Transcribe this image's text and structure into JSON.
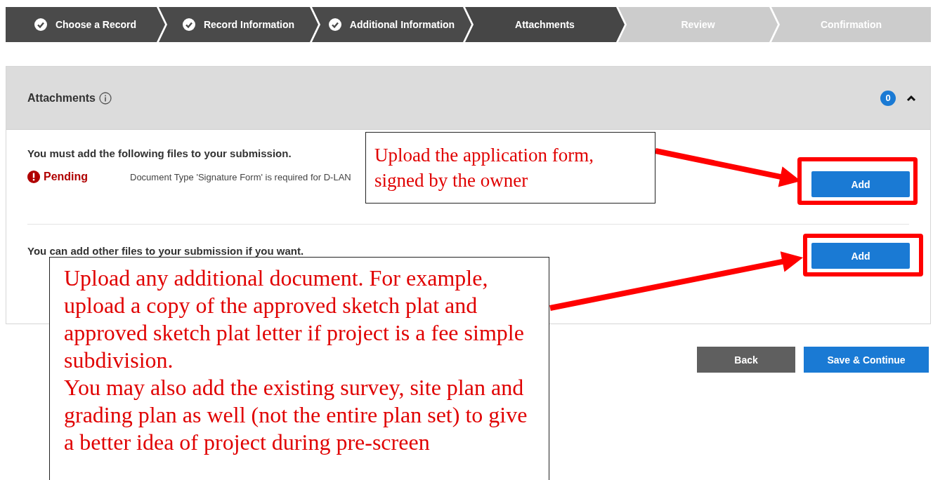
{
  "steps": [
    {
      "label": "Choose a Record",
      "complete": true,
      "selected": false
    },
    {
      "label": "Record Information",
      "complete": true,
      "selected": false
    },
    {
      "label": "Additional Information",
      "complete": true,
      "selected": false
    },
    {
      "label": "Attachments",
      "complete": false,
      "selected": true
    },
    {
      "label": "Review",
      "complete": false,
      "selected": false
    },
    {
      "label": "Confirmation",
      "complete": false,
      "selected": false
    }
  ],
  "section": {
    "title": "Attachments",
    "count": "0",
    "expanded": true,
    "required": {
      "heading": "You must add the following files to your submission.",
      "items": [
        {
          "status": "Pending",
          "description": "Document Type 'Signature Form' is required for D-LAN"
        }
      ],
      "button": "Add"
    },
    "optional": {
      "heading": "You can add other files to your submission if you want.",
      "button": "Add"
    }
  },
  "actions": [
    {
      "label": "Back",
      "kind": "secondary"
    },
    {
      "label": "Save & Continue",
      "kind": "primary"
    }
  ],
  "annotations": [
    {
      "paragraphs": [
        "Upload the application form, signed by the owner"
      ]
    },
    {
      "paragraphs": [
        "Upload any additional document. For example, upload a copy of the approved sketch plat and approved sketch plat letter if project is a fee simple subdivision.",
        "You may also add the existing survey, site plan and grading plan as well (not the entire plan set) to give a better idea of project during pre-screen"
      ]
    }
  ]
}
